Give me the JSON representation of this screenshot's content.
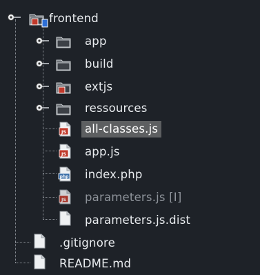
{
  "tree": {
    "root": {
      "label": "frontend",
      "expanded": true
    },
    "children": [
      {
        "label": "app",
        "icon": "folder-icon"
      },
      {
        "label": "build",
        "icon": "folder-icon"
      },
      {
        "label": "extjs",
        "icon": "folder-red-badge-icon"
      },
      {
        "label": "ressources",
        "icon": "folder-icon"
      },
      {
        "label": "all-classes.js",
        "icon": "js-file-icon",
        "selected": true
      },
      {
        "label": "app.js",
        "icon": "js-file-icon"
      },
      {
        "label": "index.php",
        "icon": "php-file-icon"
      },
      {
        "label": "parameters.js [I]",
        "icon": "js-file-icon",
        "ignored": true
      },
      {
        "label": "parameters.js.dist",
        "icon": "file-icon"
      }
    ],
    "siblings": [
      {
        "label": ".gitignore",
        "icon": "file-icon"
      },
      {
        "label": "README.md",
        "icon": "file-icon"
      }
    ]
  },
  "colors": {
    "background": "#1e2228",
    "text": "#e9ecef",
    "dim_text": "#8e939a",
    "selection": "#5d5f61",
    "js_badge": "#c0392b",
    "php_badge": "#3b6ea8"
  }
}
